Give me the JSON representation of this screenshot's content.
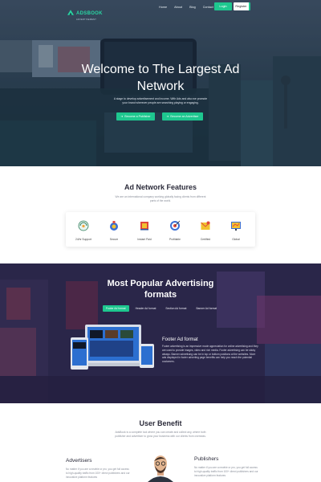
{
  "nav": {
    "logo_text": "ADSBOOK",
    "logo_sub": "ADVERTISEMENT",
    "links": [
      "Home",
      "About",
      "Blog",
      "Contact"
    ],
    "login": "Login",
    "register": "Register"
  },
  "hero": {
    "title_line1": "Welcome to The Largest Ad",
    "title_line2": "Network",
    "subtitle": "A stage to develop advertisement and income. With Ads and also we promote your brand wherever people are searching playing or engaging.",
    "button1": "Become a Publisher",
    "button2": "Become an Advertiser"
  },
  "features": {
    "title": "Ad Network Features",
    "subtitle": "We are an international company working globally facing clients from different parts of the world.",
    "items": [
      {
        "label": "24/hr Support",
        "icon": "support-icon"
      },
      {
        "label": "Secure",
        "icon": "secure-icon"
      },
      {
        "label": "Instant Paid",
        "icon": "payment-icon"
      },
      {
        "label": "Profitable",
        "icon": "target-icon"
      },
      {
        "label": "Certified",
        "icon": "certified-icon"
      },
      {
        "label": "Global",
        "icon": "global-icon"
      }
    ]
  },
  "formats": {
    "title_line1": "Most Popular Advertising",
    "title_line2": "formats",
    "tabs": [
      "Footer Ad format",
      "Header Ad format",
      "Section Ad format",
      "Banner Ad format"
    ],
    "active_tab": 0,
    "detail_title": "Footer Ad format",
    "detail_text": "Footer advertising is an impressive mode appreciation for online advertising and they are used to provide images, video and rich media. Footer advertising can be sticky always. Banner advertising can be in top or bottom positions at the websites. More ads displayed in footer adverting page benefits can help you reach the potential customers."
  },
  "benefit": {
    "title": "User Benefit",
    "subtitle": "AdsBook is a complete tool where you can create and collect any, where both publisher and advertiser to grow your business with our clients from overseas.",
    "left_title": "Advertisers",
    "left_text": "No matter if you are a newbie or pro, you get full access to high-quality traffic from 100+ direct publishers and our innovative platform features",
    "right_title": "Publishers",
    "right_text": "No matter if you are a newbie or pro, you get full access to high-quality traffic from 100+ direct publishers and our innovative platform features"
  },
  "colors": {
    "accent": "#1ec78f",
    "title_text": "#2b2b3a",
    "muted_text": "#8a8f9a"
  }
}
